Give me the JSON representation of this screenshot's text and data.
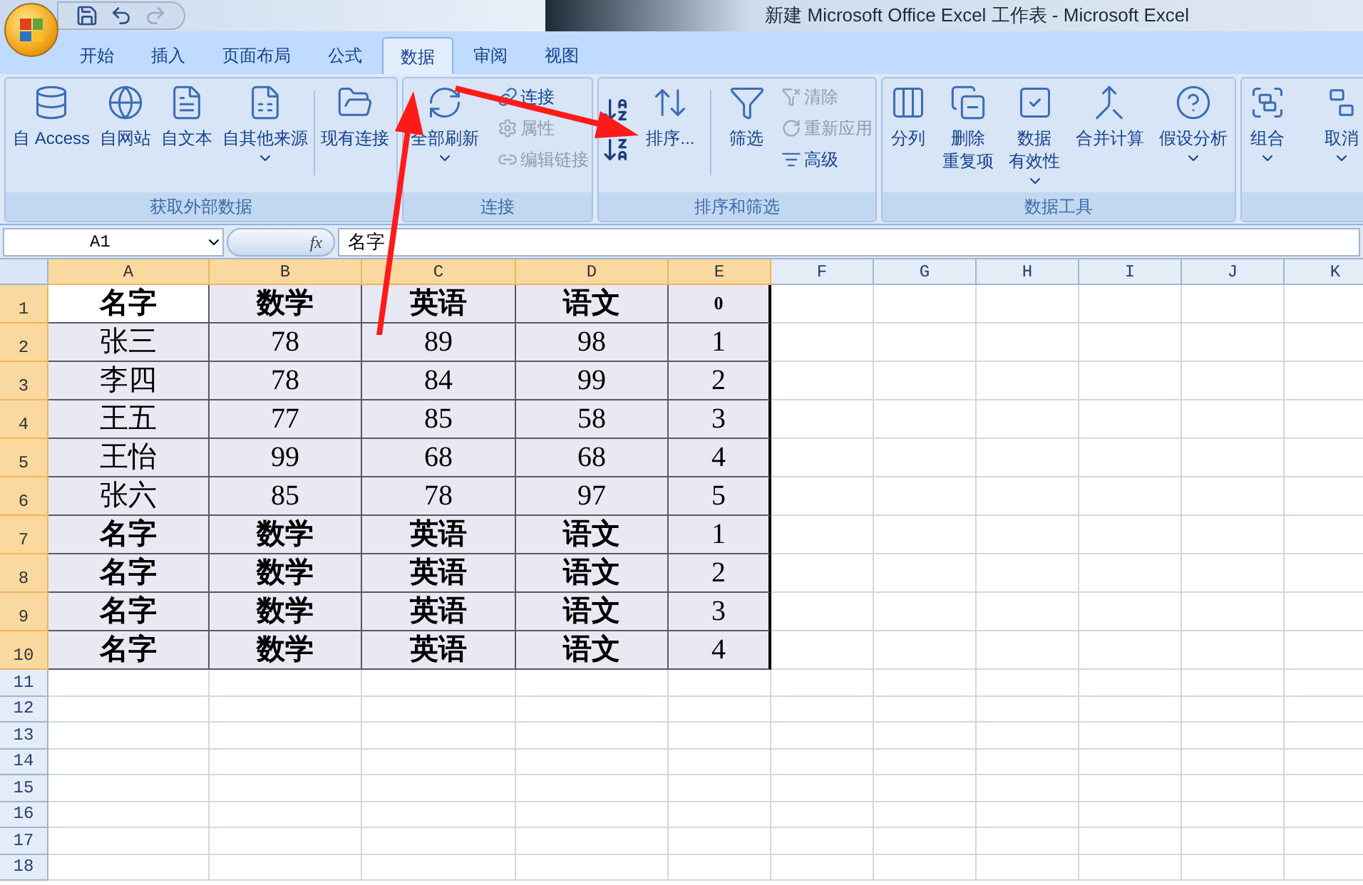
{
  "window": {
    "title": "新建 Microsoft Office Excel 工作表 - Microsoft Excel"
  },
  "tabs": [
    {
      "label": "开始",
      "selected": false
    },
    {
      "label": "插入",
      "selected": false
    },
    {
      "label": "页面布局",
      "selected": false
    },
    {
      "label": "公式",
      "selected": false
    },
    {
      "label": "数据",
      "selected": true
    },
    {
      "label": "审阅",
      "selected": false
    },
    {
      "label": "视图",
      "selected": false
    }
  ],
  "ribbon": {
    "groups": [
      {
        "title": "获取外部数据",
        "buttons": [
          {
            "kind": "large",
            "lines": [
              "自 Access"
            ],
            "dropdown": false
          },
          {
            "kind": "large",
            "lines": [
              "自网站"
            ],
            "dropdown": false
          },
          {
            "kind": "large",
            "lines": [
              "自文本"
            ],
            "dropdown": false
          },
          {
            "kind": "large",
            "lines": [
              "自其他来源"
            ],
            "dropdown": true
          },
          {
            "kind": "separator"
          },
          {
            "kind": "large",
            "lines": [
              "现有连接"
            ],
            "dropdown": false
          }
        ]
      },
      {
        "title": "连接",
        "buttons": [
          {
            "kind": "large",
            "lines": [
              "全部刷新"
            ],
            "dropdown": true
          },
          {
            "kind": "stack",
            "items": [
              {
                "label": "连接",
                "disabled": false
              },
              {
                "label": "属性",
                "disabled": true
              },
              {
                "label": "编辑链接",
                "disabled": true
              }
            ]
          }
        ]
      },
      {
        "title": "排序和筛选",
        "buttons": [
          {
            "kind": "sort"
          },
          {
            "kind": "large",
            "lines": [
              "排序..."
            ],
            "dropdown": false
          },
          {
            "kind": "separator"
          },
          {
            "kind": "large",
            "lines": [
              "筛选"
            ],
            "dropdown": false
          },
          {
            "kind": "stack",
            "items": [
              {
                "label": "清除",
                "disabled": true
              },
              {
                "label": "重新应用",
                "disabled": true
              },
              {
                "label": "高级",
                "disabled": false
              }
            ]
          }
        ]
      },
      {
        "title": "数据工具",
        "buttons": [
          {
            "kind": "large",
            "lines": [
              "分列"
            ],
            "dropdown": false
          },
          {
            "kind": "large",
            "lines": [
              "删除",
              "重复项"
            ],
            "dropdown": false
          },
          {
            "kind": "large",
            "lines": [
              "数据",
              "有效性"
            ],
            "dropdown": true
          },
          {
            "kind": "large",
            "lines": [
              "合并计算"
            ],
            "dropdown": false
          },
          {
            "kind": "large",
            "lines": [
              "假设分析"
            ],
            "dropdown": true
          }
        ]
      },
      {
        "buttons": [
          {
            "kind": "large",
            "lines": [
              "组合"
            ],
            "dropdown": true
          },
          {
            "kind": "large",
            "lines": [
              "取消"
            ],
            "dropdown": true
          }
        ]
      }
    ]
  },
  "formula_bar": {
    "name_box": "A1",
    "fx": "fx",
    "formula": "名字"
  },
  "columns": [
    {
      "label": "A",
      "selected": true
    },
    {
      "label": "B",
      "selected": true
    },
    {
      "label": "C",
      "selected": true
    },
    {
      "label": "D",
      "selected": true
    },
    {
      "label": "E",
      "selected": true
    },
    {
      "label": "F",
      "selected": false
    },
    {
      "label": "G",
      "selected": false
    },
    {
      "label": "H",
      "selected": false
    },
    {
      "label": "I",
      "selected": false
    },
    {
      "label": "J",
      "selected": false
    },
    {
      "label": "K",
      "selected": false
    }
  ],
  "rows": [
    {
      "number": "1",
      "selected": true,
      "cells": [
        {
          "text": "名字",
          "kind": "header",
          "selected": true
        },
        {
          "text": "数学",
          "kind": "header",
          "selected": false
        },
        {
          "text": "英语",
          "kind": "header",
          "selected": false
        },
        {
          "text": "语文",
          "kind": "header",
          "selected": false
        },
        {
          "text": "0",
          "kind": "index",
          "selected": false
        }
      ]
    },
    {
      "number": "2",
      "selected": true,
      "cells": [
        {
          "text": "张三",
          "kind": "value",
          "selected": false
        },
        {
          "text": "78",
          "kind": "value",
          "selected": false
        },
        {
          "text": "89",
          "kind": "value",
          "selected": false
        },
        {
          "text": "98",
          "kind": "value",
          "selected": false
        },
        {
          "text": "1",
          "kind": "value",
          "selected": false
        }
      ]
    },
    {
      "number": "3",
      "selected": true,
      "cells": [
        {
          "text": "李四",
          "kind": "value",
          "selected": false
        },
        {
          "text": "78",
          "kind": "value",
          "selected": false
        },
        {
          "text": "84",
          "kind": "value",
          "selected": false
        },
        {
          "text": "99",
          "kind": "value",
          "selected": false
        },
        {
          "text": "2",
          "kind": "value",
          "selected": false
        }
      ]
    },
    {
      "number": "4",
      "selected": true,
      "cells": [
        {
          "text": "王五",
          "kind": "value",
          "selected": false
        },
        {
          "text": "77",
          "kind": "value",
          "selected": false
        },
        {
          "text": "85",
          "kind": "value",
          "selected": false
        },
        {
          "text": "58",
          "kind": "value",
          "selected": false
        },
        {
          "text": "3",
          "kind": "value",
          "selected": false
        }
      ]
    },
    {
      "number": "5",
      "selected": true,
      "cells": [
        {
          "text": "王怡",
          "kind": "value",
          "selected": false
        },
        {
          "text": "99",
          "kind": "value",
          "selected": false
        },
        {
          "text": "68",
          "kind": "value",
          "selected": false
        },
        {
          "text": "68",
          "kind": "value",
          "selected": false
        },
        {
          "text": "4",
          "kind": "value",
          "selected": false
        }
      ]
    },
    {
      "number": "6",
      "selected": true,
      "cells": [
        {
          "text": "张六",
          "kind": "value",
          "selected": false
        },
        {
          "text": "85",
          "kind": "value",
          "selected": false
        },
        {
          "text": "78",
          "kind": "value",
          "selected": false
        },
        {
          "text": "97",
          "kind": "value",
          "selected": false
        },
        {
          "text": "5",
          "kind": "value",
          "selected": false
        }
      ]
    },
    {
      "number": "7",
      "selected": true,
      "cells": [
        {
          "text": "名字",
          "kind": "header",
          "selected": false
        },
        {
          "text": "数学",
          "kind": "header",
          "selected": false
        },
        {
          "text": "英语",
          "kind": "header",
          "selected": false
        },
        {
          "text": "语文",
          "kind": "header",
          "selected": false
        },
        {
          "text": "1",
          "kind": "value",
          "selected": false
        }
      ]
    },
    {
      "number": "8",
      "selected": true,
      "cells": [
        {
          "text": "名字",
          "kind": "header",
          "selected": false
        },
        {
          "text": "数学",
          "kind": "header",
          "selected": false
        },
        {
          "text": "英语",
          "kind": "header",
          "selected": false
        },
        {
          "text": "语文",
          "kind": "header",
          "selected": false
        },
        {
          "text": "2",
          "kind": "value",
          "selected": false
        }
      ]
    },
    {
      "number": "9",
      "selected": true,
      "cells": [
        {
          "text": "名字",
          "kind": "header",
          "selected": false
        },
        {
          "text": "数学",
          "kind": "header",
          "selected": false
        },
        {
          "text": "英语",
          "kind": "header",
          "selected": false
        },
        {
          "text": "语文",
          "kind": "header",
          "selected": false
        },
        {
          "text": "3",
          "kind": "value",
          "selected": false
        }
      ]
    },
    {
      "number": "10",
      "selected": true,
      "cells": [
        {
          "text": "名字",
          "kind": "header",
          "selected": false
        },
        {
          "text": "数学",
          "kind": "header",
          "selected": false
        },
        {
          "text": "英语",
          "kind": "header",
          "selected": false
        },
        {
          "text": "语文",
          "kind": "header",
          "selected": false
        },
        {
          "text": "4",
          "kind": "value",
          "selected": false
        }
      ]
    },
    {
      "number": "11",
      "selected": false,
      "cells": []
    },
    {
      "number": "12",
      "selected": false,
      "cells": []
    },
    {
      "number": "13",
      "selected": false,
      "cells": []
    },
    {
      "number": "14",
      "selected": false,
      "cells": []
    },
    {
      "number": "15",
      "selected": false,
      "cells": []
    },
    {
      "number": "16",
      "selected": false,
      "cells": []
    },
    {
      "number": "17",
      "selected": false,
      "cells": []
    },
    {
      "number": "18",
      "selected": false,
      "cells": []
    }
  ]
}
